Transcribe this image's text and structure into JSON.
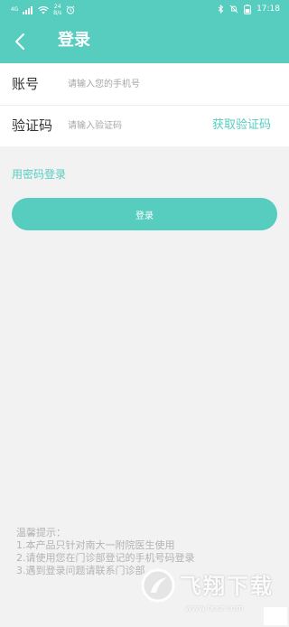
{
  "status_bar": {
    "signal_text": "4G",
    "net_speed": "24\nB/s",
    "time": "17:18"
  },
  "header": {
    "title": "登录",
    "back_icon": "chevron-left-icon"
  },
  "form": {
    "account_label": "账号",
    "account_placeholder": "请输入您的手机号",
    "code_label": "验证码",
    "code_placeholder": "请输入验证码",
    "get_code": "获取验证码"
  },
  "password_login_link": "用密码登录",
  "login_button": "登录",
  "tips": {
    "title": "温馨提示：",
    "lines": [
      "1.本产品只针对南大一附院医生使用",
      "2.请使用您在门诊部登记的手机号码登录",
      "3.遇到登录问题请联系门诊部"
    ]
  },
  "watermark": {
    "text": "飞翔下载",
    "url": "www.fxxz.com"
  },
  "colors": {
    "primary": "#56cdbf",
    "background": "#f2f2f2",
    "tip_text": "#b3b3b3"
  }
}
